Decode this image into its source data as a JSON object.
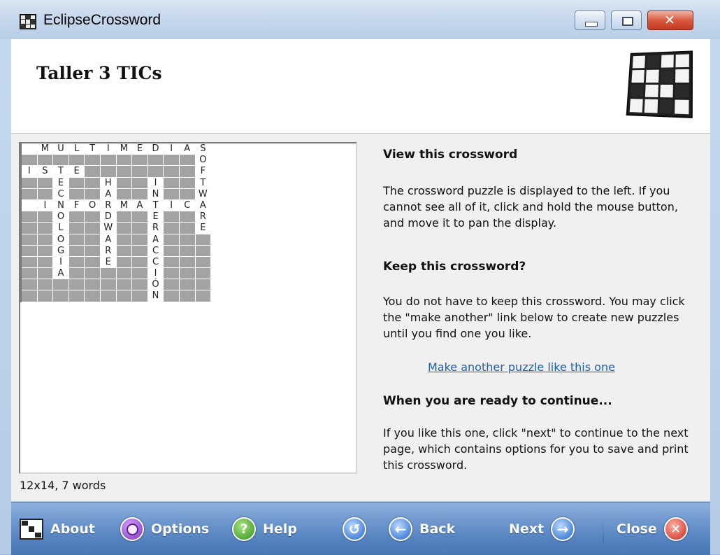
{
  "window": {
    "title": "EclipseCrossword"
  },
  "header": {
    "title": "Taller 3 TICs"
  },
  "puzzle": {
    "cols": 12,
    "rows": [
      [
        ".",
        "M",
        "U",
        "L",
        "T",
        "I",
        "M",
        "E",
        "D",
        "I",
        "A",
        "S"
      ],
      [
        "#",
        "#",
        "#",
        "#",
        "#",
        "#",
        "#",
        "#",
        "#",
        "#",
        "#",
        "O"
      ],
      [
        "I",
        "S",
        "T",
        "E",
        "#",
        "#",
        "#",
        "#",
        "#",
        "#",
        "#",
        "F"
      ],
      [
        "#",
        "#",
        "E",
        "#",
        "#",
        "H",
        "#",
        "#",
        "I",
        "#",
        "#",
        "T"
      ],
      [
        "#",
        "#",
        "C",
        "#",
        "#",
        "A",
        "#",
        "#",
        "N",
        "#",
        "#",
        "W"
      ],
      [
        ".",
        "I",
        "N",
        "F",
        "O",
        "R",
        "M",
        "A",
        "T",
        "I",
        "C",
        "A"
      ],
      [
        "#",
        "#",
        "O",
        "#",
        "#",
        "D",
        "#",
        "#",
        "E",
        "#",
        "#",
        "R"
      ],
      [
        "#",
        "#",
        "L",
        "#",
        "#",
        "W",
        "#",
        "#",
        "R",
        "#",
        "#",
        "E"
      ],
      [
        "#",
        "#",
        "O",
        "#",
        "#",
        "A",
        "#",
        "#",
        "A",
        "#",
        "#",
        "#"
      ],
      [
        "#",
        "#",
        "G",
        "#",
        "#",
        "R",
        "#",
        "#",
        "C",
        "#",
        "#",
        "#"
      ],
      [
        "#",
        "#",
        "I",
        "#",
        "#",
        "E",
        "#",
        "#",
        "C",
        "#",
        "#",
        "#"
      ],
      [
        "#",
        "#",
        "A",
        "#",
        "#",
        "#",
        "#",
        "#",
        "I",
        "#",
        "#",
        "#"
      ],
      [
        "#",
        "#",
        "#",
        "#",
        "#",
        "#",
        "#",
        "#",
        "Ó",
        "#",
        "#",
        "#"
      ],
      [
        "#",
        "#",
        "#",
        "#",
        "#",
        "#",
        "#",
        "#",
        "N",
        "#",
        "#",
        "#"
      ]
    ],
    "status": "12x14, 7 words"
  },
  "info": {
    "view_heading": "View this crossword",
    "view_text": "The crossword puzzle is displayed to the left. If you cannot see all of it, click and hold the mouse button, and move it to pan the display.",
    "keep_heading": "Keep this crossword?",
    "keep_text": "You do not have to keep this crossword.  You may click the \"make another\" link below to create new puzzles until you find one you like.",
    "make_another_link": "Make another puzzle like this one",
    "ready_heading": "When you are ready to continue...",
    "ready_text": "If you like this one, click \"next\" to continue to the next page, which contains options for you to save and print this crossword."
  },
  "toolbar": {
    "about": "About",
    "options": "Options",
    "help": "Help",
    "back": "Back",
    "next": "Next",
    "close": "Close"
  }
}
